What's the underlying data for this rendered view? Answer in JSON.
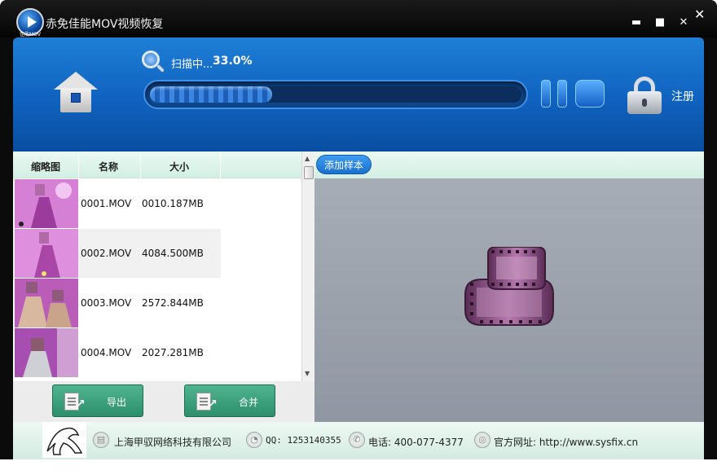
{
  "window": {
    "title": "赤免佳能MOV视频恢复",
    "logo_text": "佳能MOV",
    "controls": {
      "minimize": "▬",
      "maximize": "■",
      "close": "✕",
      "outer_close": "✕"
    }
  },
  "header": {
    "scan_label": "扫描中...",
    "scan_percent": "33.0%",
    "progress_fraction": 0.33,
    "register_label": "注册"
  },
  "file_list": {
    "columns": [
      "缩略图",
      "名称",
      "大小"
    ],
    "rows": [
      {
        "name": "0001.MOV",
        "size": "0010.187MB"
      },
      {
        "name": "0002.MOV",
        "size": "4084.500MB"
      },
      {
        "name": "0003.MOV",
        "size": "2572.844MB"
      },
      {
        "name": "0004.MOV",
        "size": "2027.281MB"
      }
    ],
    "scroll_up": "▲",
    "scroll_down": "▼"
  },
  "actions": {
    "export_label": "导出",
    "merge_label": "合并"
  },
  "preview": {
    "add_sample_label": "添加样本"
  },
  "footer": {
    "company": "上海甲驭网络科技有限公司",
    "qq": "QQ: 1253140355",
    "phone": "电话: 400-077-4377",
    "website": "官方网址: http://www.sysfix.cn"
  },
  "colors": {
    "header_blue": "#0f62bf",
    "action_green": "#2d8f6c",
    "accent_blue": "#1b6fcc",
    "film_purple": "#8a4f80"
  }
}
